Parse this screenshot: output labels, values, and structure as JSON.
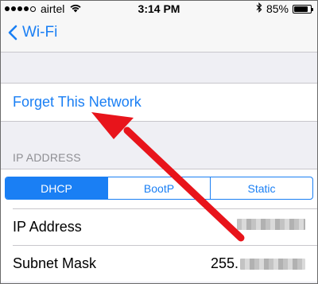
{
  "status_bar": {
    "carrier": "airtel",
    "time": "3:14 PM",
    "battery": "85%",
    "battery_level": 0.85,
    "signal_bars": 4
  },
  "nav": {
    "back_label": "Wi-Fi"
  },
  "forget_label": "Forget This Network",
  "section_header": "IP ADDRESS",
  "segments": [
    {
      "label": "DHCP",
      "active": true
    },
    {
      "label": "BootP",
      "active": false
    },
    {
      "label": "Static",
      "active": false
    }
  ],
  "rows": [
    {
      "label": "IP Address",
      "value_prefix": ""
    },
    {
      "label": "Subnet Mask",
      "value_prefix": "255."
    }
  ],
  "colors": {
    "accent": "#1a7ff4",
    "annotation": "#e8141b"
  }
}
